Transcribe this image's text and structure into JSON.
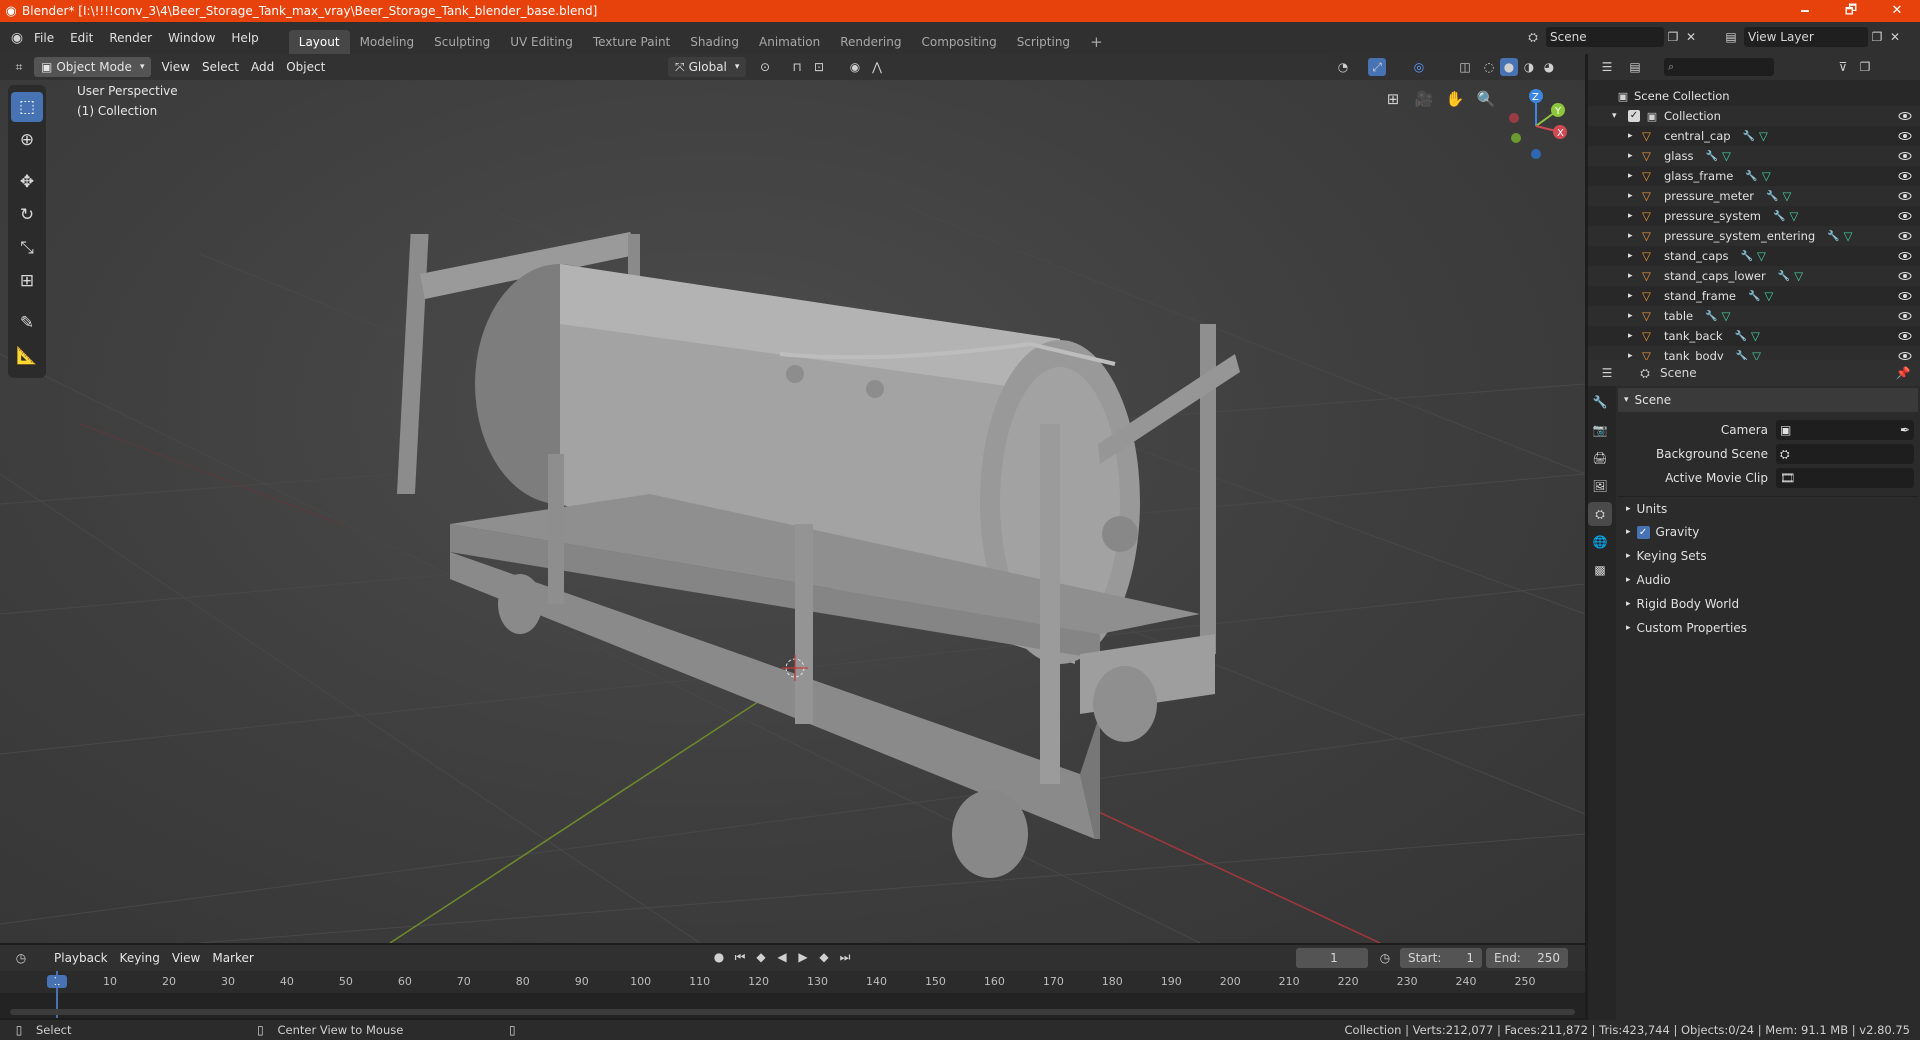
{
  "title_bar": {
    "title": "Blender* [I:\\!!!!conv_3\\4\\Beer_Storage_Tank_max_vray\\Beer_Storage_Tank_blender_base.blend]",
    "minimize": "🗕",
    "maximize": "🗗",
    "close": "✕"
  },
  "menubar": {
    "menus": [
      "File",
      "Edit",
      "Render",
      "Window",
      "Help"
    ],
    "workspaces": [
      "Layout",
      "Modeling",
      "Sculpting",
      "UV Editing",
      "Texture Paint",
      "Shading",
      "Animation",
      "Rendering",
      "Compositing",
      "Scripting"
    ],
    "add_workspace": "+",
    "scene_label": "Scene",
    "view_layer_label": "View Layer"
  },
  "viewport_header": {
    "mode": "Object Mode",
    "menus": [
      "View",
      "Select",
      "Add",
      "Object"
    ],
    "transform_orientation": "Global"
  },
  "viewport": {
    "perspective_label": "User Perspective",
    "collection_label": "(1) Collection",
    "gizmo": {
      "x": "X",
      "y": "Y",
      "z": "Z"
    }
  },
  "outliner": {
    "scene_collection": "Scene Collection",
    "collection": "Collection",
    "objects": [
      "central_cap",
      "glass",
      "glass_frame",
      "pressure_meter",
      "pressure_system",
      "pressure_system_entering",
      "stand_caps",
      "stand_caps_lower",
      "stand_frame",
      "table",
      "tank_back",
      "tank_body"
    ]
  },
  "properties": {
    "context_label": "Scene",
    "panel_title": "Scene",
    "fields": [
      {
        "label": "Camera",
        "value": ""
      },
      {
        "label": "Background Scene",
        "value": ""
      },
      {
        "label": "Active Movie Clip",
        "value": ""
      }
    ],
    "sections": [
      "Units",
      "Gravity",
      "Keying Sets",
      "Audio",
      "Rigid Body World",
      "Custom Properties"
    ],
    "gravity_checked": true
  },
  "timeline": {
    "menus": [
      "Playback",
      "Keying",
      "View",
      "Marker"
    ],
    "current_frame": "1",
    "start_label": "Start:",
    "start_value": "1",
    "end_label": "End:",
    "end_value": "250",
    "ruler_labels": [
      "1",
      "10",
      "20",
      "30",
      "40",
      "50",
      "60",
      "70",
      "80",
      "90",
      "100",
      "110",
      "120",
      "130",
      "140",
      "150",
      "160",
      "170",
      "180",
      "190",
      "200",
      "210",
      "220",
      "230",
      "240",
      "250"
    ]
  },
  "status_bar": {
    "left_action": "Select",
    "middle_action": "Center View to Mouse",
    "stats": "Collection | Verts:212,077 | Faces:211,872 | Tris:423,744 | Objects:0/24 | Mem: 91.1 MB | v2.80.75"
  },
  "colors": {
    "title_bar": "#e8420c",
    "active_tool": "#4772b3",
    "object_icon": "#e8973a",
    "modifier_icon": "#5a9ee8",
    "mesh_icon": "#45d0a4",
    "x_axis": "#d04a52",
    "y_axis": "#8cc73c",
    "z_axis": "#3d86e0"
  }
}
